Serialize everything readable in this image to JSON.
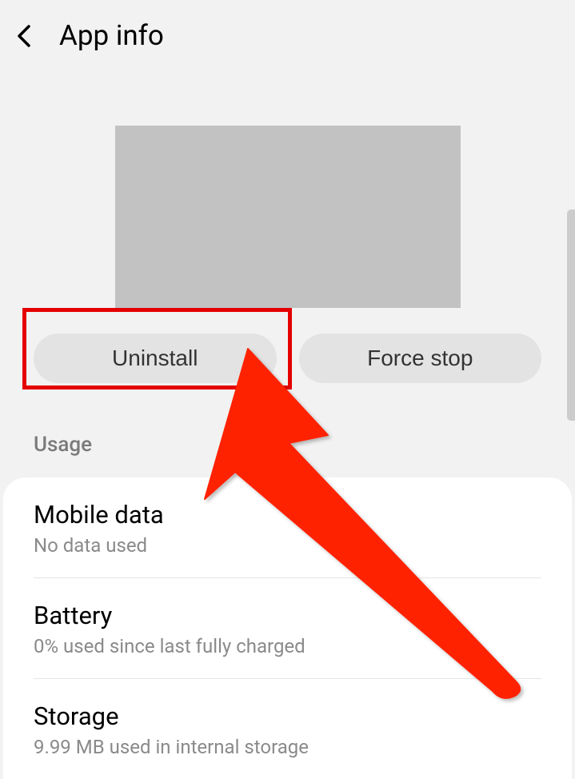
{
  "header": {
    "title": "App info"
  },
  "actions": {
    "uninstall": "Uninstall",
    "force_stop": "Force stop"
  },
  "section": {
    "usage_label": "Usage"
  },
  "usage_items": {
    "mobile_data": {
      "title": "Mobile data",
      "subtitle": "No data used"
    },
    "battery": {
      "title": "Battery",
      "subtitle": "0% used since last fully charged"
    },
    "storage": {
      "title": "Storage",
      "subtitle": "9.99 MB used in internal storage"
    }
  }
}
